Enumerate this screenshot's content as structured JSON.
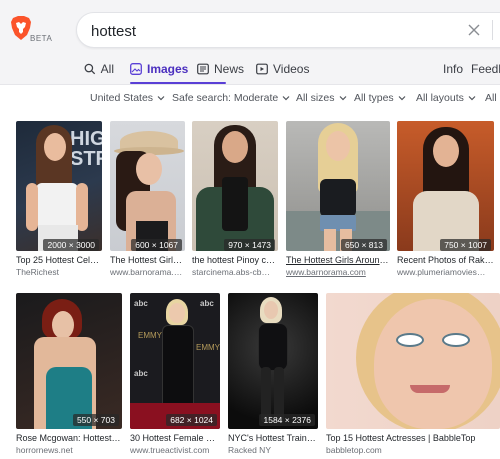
{
  "header": {
    "beta_label": "BETA",
    "search_value": "hottest",
    "brand_color": "#fb542b"
  },
  "tabs": [
    {
      "label": "All",
      "icon": "search-icon"
    },
    {
      "label": "Images",
      "icon": "image-icon",
      "active": true
    },
    {
      "label": "News",
      "icon": "news-icon"
    },
    {
      "label": "Videos",
      "icon": "video-icon"
    }
  ],
  "tabs_right": {
    "info": "Info",
    "feedback": "Feedb"
  },
  "filters": [
    {
      "label": "United States"
    },
    {
      "label": "Safe search: Moderate"
    },
    {
      "label": "All sizes"
    },
    {
      "label": "All types"
    },
    {
      "label": "All layouts"
    },
    {
      "label": "All c"
    }
  ],
  "results": [
    {
      "title": "Top 25 Hottest Cele…",
      "source": "TheRichest",
      "dims": "2000 × 3000"
    },
    {
      "title": "The Hottest Girls …",
      "source": "www.barnorama.com",
      "dims": "600 × 1067"
    },
    {
      "title": "the hottest Pinoy c…",
      "source": "starcinema.abs-cb…",
      "dims": "970 × 1473"
    },
    {
      "title": "The Hottest Girls Around …",
      "source": "www.barnorama.com",
      "dims": "650 × 813"
    },
    {
      "title": "Recent Photos of Rakul…",
      "source": "www.plumeriamovies…",
      "dims": "750 × 1007"
    },
    {
      "title": "Rose Mcgowan: Hottest …",
      "source": "horrornews.net",
      "dims": "550 × 703"
    },
    {
      "title": "30 Hottest Female S…",
      "source": "www.trueactivist.com",
      "dims": "682 × 1024"
    },
    {
      "title": "NYC's Hottest Trainer…",
      "source": "Racked NY",
      "dims": "1584 × 2376"
    },
    {
      "title": "Top 15 Hottest Actresses | BabbleTop",
      "source": "babbletop.com",
      "dims": ""
    }
  ]
}
